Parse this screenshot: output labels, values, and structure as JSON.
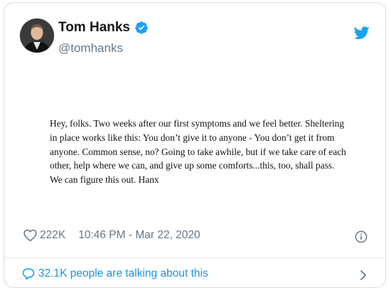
{
  "tweet": {
    "display_name": "Tom Hanks",
    "handle": "@tomhanks",
    "text": "Hey, folks. Two weeks after our first symptoms and we feel better. Sheltering in place works like this: You don’t give it to anyone - You don’t get it from anyone. Common sense, no? Going to take awhile, but if we take care of each other, help where we can, and give up some comforts...this, too, shall pass. We can figure this out.  Hanx",
    "likes": "222K",
    "timestamp": "10:46 PM - Mar 22, 2020",
    "conversation": "32.1K people are talking about this"
  },
  "icons": {
    "verified": "verified-badge-icon",
    "brand": "twitter-bird-icon",
    "like": "heart-icon",
    "info": "info-icon",
    "reply": "speech-bubble-icon",
    "more": "chevron-right-icon"
  },
  "colors": {
    "twitter_blue": "#1da1f2",
    "link_blue": "#1b95e0",
    "secondary_text": "#657786",
    "border": "#d8dde1"
  }
}
